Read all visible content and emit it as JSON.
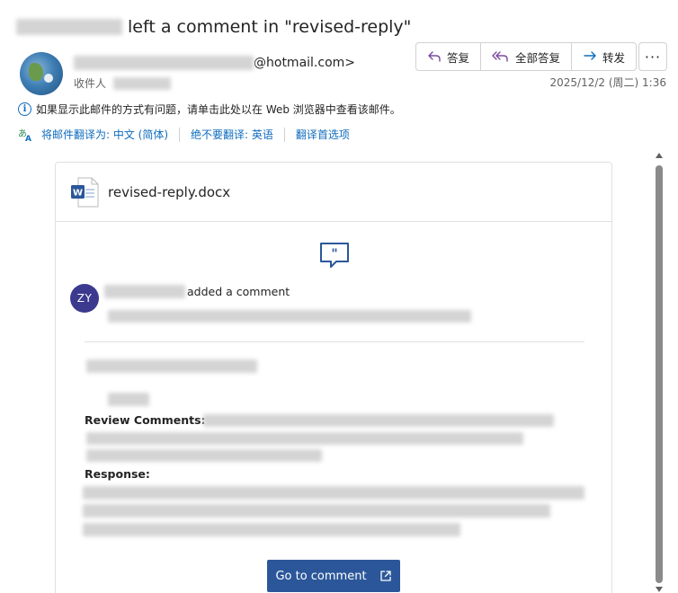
{
  "email": {
    "subject_suffix": "left a comment in \"revised-reply\"",
    "sender_domain": "@hotmail.com>",
    "recipient_label": "收件人",
    "date": "2025/12/2 (周二) 1:36"
  },
  "toolbar": {
    "reply_label": "答复",
    "reply_all_label": "全部答复",
    "forward_label": "转发",
    "more_label": "···"
  },
  "info_bar": {
    "text": "如果显示此邮件的方式有问题，请单击此处以在 Web 浏览器中查看该邮件。"
  },
  "translate_bar": {
    "translate_to": "将邮件翻译为: 中文 (简体)",
    "never_translate": "绝不要翻译: 英语",
    "preferences": "翻译首选项"
  },
  "card": {
    "file_name": "revised-reply.docx",
    "commenter_initials": "ZY",
    "action_text": "added a comment",
    "review_label": "Review Comments:",
    "response_label": "Response:",
    "go_button_label": "Go to comment"
  },
  "colors": {
    "accent_blue": "#0f6cbd",
    "word_blue": "#2b579a",
    "avatar_purple": "#3b3a8f",
    "reply_purple": "#7a4a9f"
  },
  "icons": {
    "reply": "reply-arrow-icon",
    "reply_all": "reply-all-icon",
    "forward": "forward-arrow-icon",
    "info": "info-icon",
    "translate": "translate-icon",
    "word": "word-doc-icon",
    "comment": "comment-quote-icon",
    "open_external": "open-external-icon"
  }
}
